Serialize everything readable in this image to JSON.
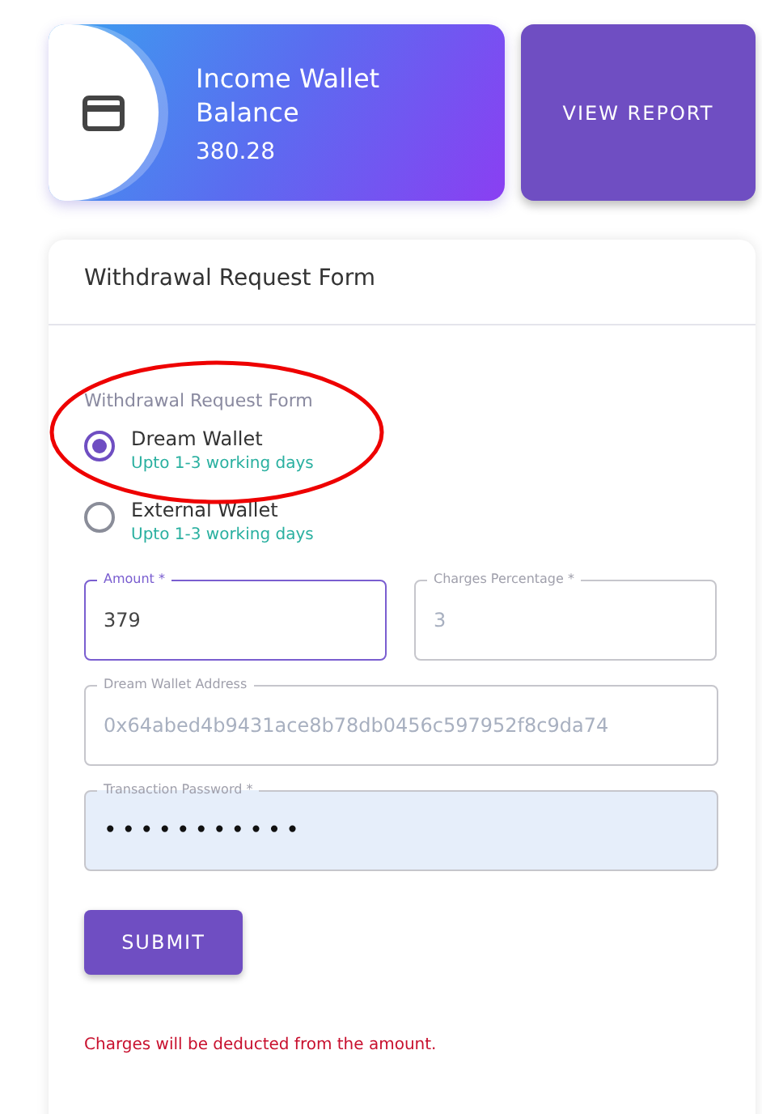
{
  "balance_card": {
    "title": "Income Wallet Balance",
    "amount": "380.28"
  },
  "report_button": {
    "label": "VIEW REPORT"
  },
  "form": {
    "title": "Withdrawal Request Form",
    "group_label": "Withdrawal Request Form",
    "options": [
      {
        "label": "Dream Wallet",
        "hint": "Upto 1-3 working days",
        "selected": true
      },
      {
        "label": "External Wallet",
        "hint": "Upto 1-3 working days",
        "selected": false
      }
    ],
    "fields": [
      {
        "label": "Amount *",
        "value": "379",
        "focused": true,
        "disabled": false,
        "filled": false,
        "kind": "text"
      },
      {
        "label": "Charges Percentage *",
        "value": "3",
        "focused": false,
        "disabled": true,
        "filled": false,
        "kind": "text"
      },
      {
        "label": "Dream Wallet Address",
        "value": "0x64abed4b9431ace8b78db0456c597952f8c9da74",
        "focused": false,
        "disabled": true,
        "filled": false,
        "kind": "text"
      },
      {
        "label": "Transaction Password *",
        "value": "•••••••••••",
        "focused": false,
        "disabled": false,
        "filled": true,
        "kind": "password"
      }
    ],
    "submit": "SUBMIT",
    "note": "Charges will be deducted from the amount."
  }
}
